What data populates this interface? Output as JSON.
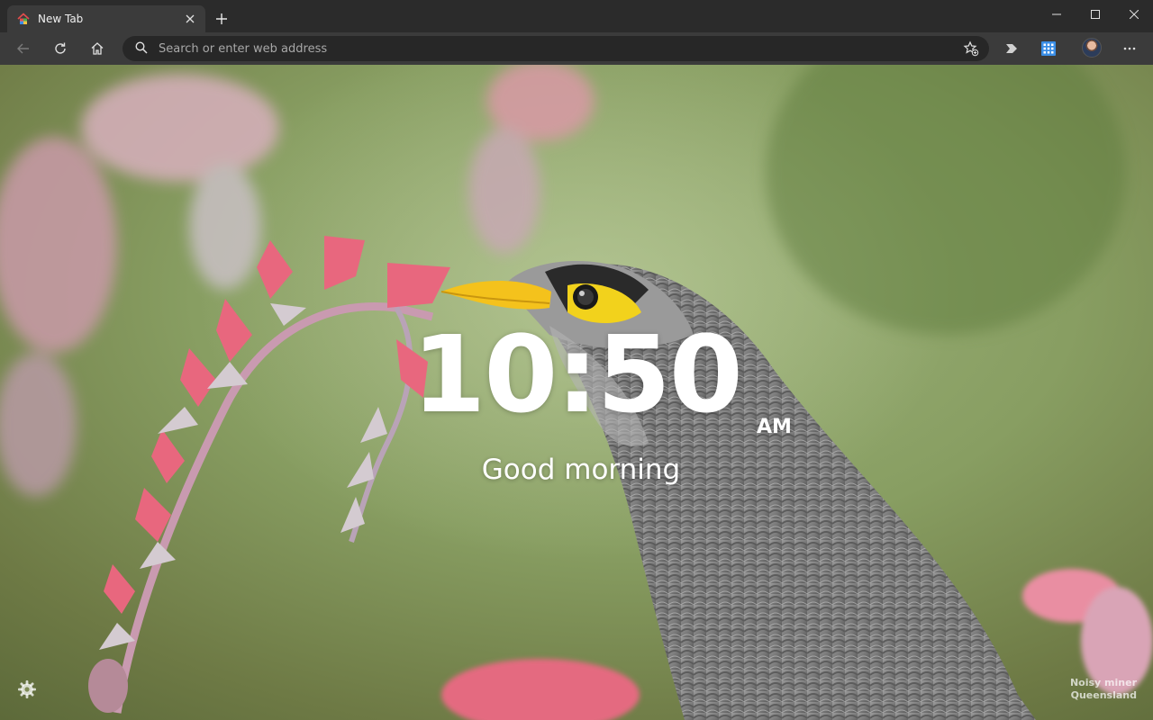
{
  "tab": {
    "title": "New Tab",
    "close_symbol": "✕",
    "new_tab_symbol": "+"
  },
  "window": {
    "minimize": "minimize-icon",
    "maximize": "maximize-icon",
    "close": "close-icon"
  },
  "toolbar": {
    "address_placeholder": "Search or enter web address",
    "icons": [
      "back-icon",
      "refresh-icon",
      "home-icon",
      "search-icon",
      "favorite-add-icon",
      "extension-icon",
      "collections-grid-icon",
      "profile-avatar",
      "more-icon"
    ]
  },
  "newtab": {
    "time": "10:50",
    "ampm": "AM",
    "greeting": "Good morning",
    "credit_line1": "Noisy miner",
    "credit_line2": "Queensland"
  },
  "colors": {
    "tabstrip": "#2b2b2b",
    "toolbar": "#3b3b3b",
    "addressbar": "#272727",
    "accent_blue": "#3a8ee6"
  }
}
